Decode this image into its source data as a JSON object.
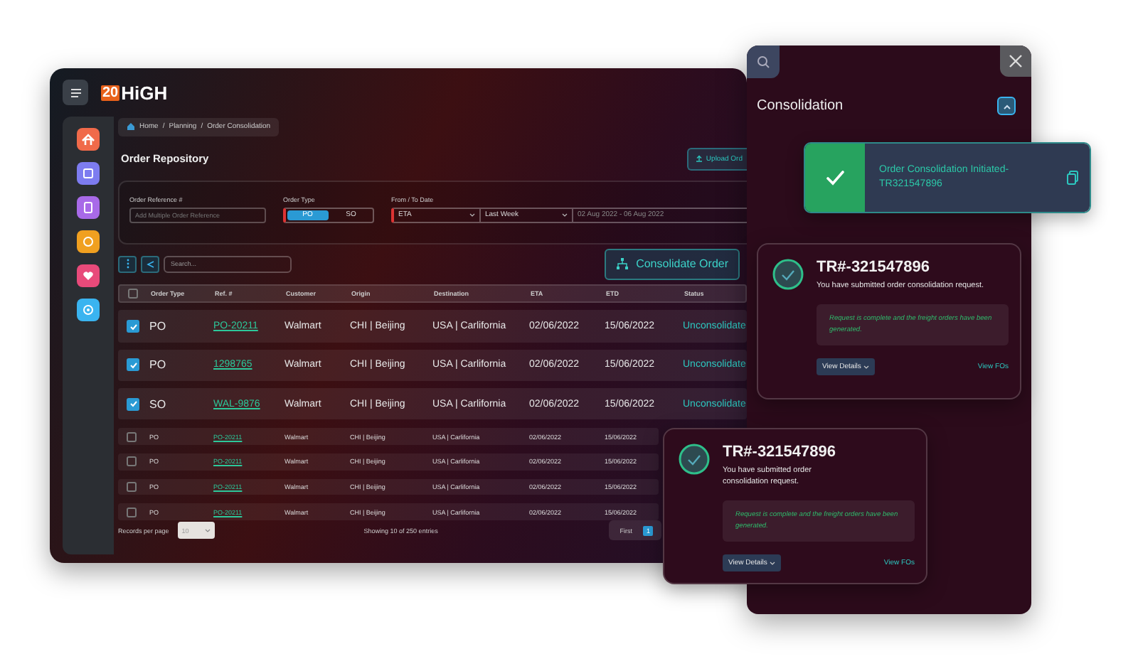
{
  "app": {
    "logo_badge": "20",
    "logo_text": "HiGH"
  },
  "breadcrumb": {
    "separator": "/",
    "items": [
      "Home",
      "Planning",
      "Order Consolidation"
    ]
  },
  "page_title": "Order Repository",
  "upload_button": "Upload Ord",
  "filters": {
    "order_reference": {
      "label": "Order Reference #",
      "placeholder": "Add Multiple Order Reference"
    },
    "order_type": {
      "label": "Order Type",
      "options": [
        {
          "label": "PO",
          "selected": true
        },
        {
          "label": "SO",
          "selected": false
        }
      ]
    },
    "date": {
      "label": "From / To Date",
      "basis": "ETA",
      "range": "Last Week",
      "dates": "02 Aug 2022 - 06 Aug 2022"
    }
  },
  "search": {
    "placeholder": "Search..."
  },
  "consolidate_button": "Consolidate Order",
  "table": {
    "all_checked": false,
    "columns": [
      "Order Type",
      "Ref. #",
      "Customer",
      "Origin",
      "Destination",
      "ETA",
      "ETD",
      "Status"
    ],
    "rows": [
      {
        "kind": "large",
        "checked": true,
        "cells": [
          "PO",
          "PO-20211",
          "Walmart",
          "CHI |  Beijing",
          "USA  | Carlifornia",
          "02/06/2022",
          "15/06/2022",
          "Unconsolidate"
        ]
      },
      {
        "kind": "large",
        "checked": true,
        "cells": [
          "PO",
          "1298765",
          "Walmart",
          "CHI |  Beijing",
          "USA  | Carlifornia",
          "02/06/2022",
          "15/06/2022",
          "Unconsolidate"
        ]
      },
      {
        "kind": "large",
        "checked": true,
        "cells": [
          "SO",
          "WAL-9876",
          "Walmart",
          "CHI |  Beijing",
          "USA  | Carlifornia",
          "02/06/2022",
          "15/06/2022",
          "Unconsolidate"
        ]
      },
      {
        "kind": "small",
        "checked": false,
        "cells": [
          "PO",
          "PO-20211",
          "Walmart",
          "CHI |  Beijing",
          "USA  | Carlifornia",
          "02/06/2022",
          "15/06/2022"
        ]
      },
      {
        "kind": "small",
        "checked": false,
        "cells": [
          "PO",
          "PO-20211",
          "Walmart",
          "CHI |  Beijing",
          "USA  | Carlifornia",
          "02/06/2022",
          "15/06/2022"
        ]
      },
      {
        "kind": "small",
        "checked": false,
        "cells": [
          "PO",
          "PO-20211",
          "Walmart",
          "CHI |  Beijing",
          "USA  | Carlifornia",
          "02/06/2022",
          "15/06/2022"
        ]
      },
      {
        "kind": "small",
        "checked": false,
        "cells": [
          "PO",
          "PO-20211",
          "Walmart",
          "CHI |  Beijing",
          "USA  | Carlifornia",
          "02/06/2022",
          "15/06/2022"
        ]
      }
    ]
  },
  "footer": {
    "records_label": "Records per page",
    "per_page": "10",
    "showing": "Showing 10 of 250 entries",
    "pages": [
      {
        "label": "First",
        "selected": false
      },
      {
        "label": "1",
        "selected": true
      }
    ]
  },
  "panel": {
    "title": "Consolidation",
    "expanded": true
  },
  "toast": {
    "message": "Order Consolidation Initiated-TR321547896"
  },
  "cards": [
    {
      "title": "TR#-321547896",
      "message": "You have submitted order consolidation request.",
      "note": "Request is complete and the freight orders have been generated.",
      "details_button": "View Details",
      "link": "View FOs"
    },
    {
      "title": "TR#-321547896",
      "message": "You have submitted order consolidation request.",
      "note": "Request is complete and the freight orders have been generated.",
      "details_button": "View Details",
      "link": "View FOs"
    }
  ]
}
